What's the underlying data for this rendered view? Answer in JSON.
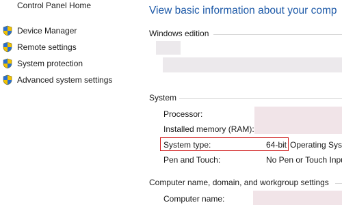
{
  "sidebar": {
    "home_link": "Control Panel Home",
    "items": [
      {
        "label": "Device Manager",
        "icon": "uac-shield-icon"
      },
      {
        "label": "Remote settings",
        "icon": "uac-shield-icon"
      },
      {
        "label": "System protection",
        "icon": "uac-shield-icon"
      },
      {
        "label": "Advanced system settings",
        "icon": "uac-shield-icon"
      }
    ]
  },
  "main": {
    "heading": "View basic information about your comp",
    "windows_edition": {
      "title": "Windows edition"
    },
    "system": {
      "title": "System",
      "rows": [
        {
          "label": "Processor:",
          "value": ""
        },
        {
          "label": "Installed memory (RAM):",
          "value": ""
        },
        {
          "label": "System type:",
          "value": "64-bit",
          "extra": "Operating Syst"
        },
        {
          "label": "Pen and Touch:",
          "value": "No Pen or Touch Inpu"
        }
      ]
    },
    "computer_name": {
      "title": "Computer name, domain, and workgroup settings",
      "rows": [
        {
          "label": "Computer name:",
          "value": ""
        }
      ]
    }
  },
  "colors": {
    "heading_blue": "#1e5aa8",
    "highlight_red": "#d01c1c",
    "redaction_gray": "#ece9ec"
  }
}
